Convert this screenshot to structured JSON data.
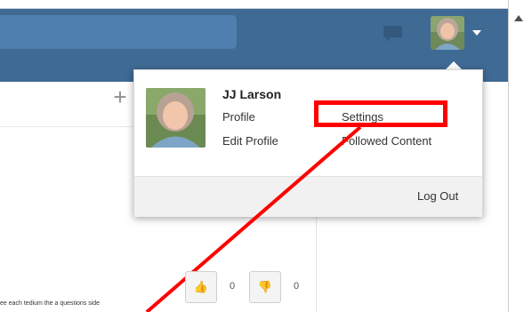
{
  "user": {
    "name": "JJ Larson"
  },
  "menu": {
    "profile": "Profile",
    "edit_profile": "Edit Profile",
    "settings": "Settings",
    "followed_content": "Followed Content",
    "logout": "Log Out"
  },
  "toolbar": {
    "plus": "+"
  },
  "votes": {
    "up_icon": "👍",
    "up_count": "0",
    "down_icon": "👎",
    "down_count": "0"
  },
  "bottom_note": "ee each tedium the a questions side",
  "colors": {
    "header": "#3f6a94",
    "search": "#4f7fae",
    "highlight": "#ff0000"
  },
  "icons": {
    "chat": "chat-bubble-icon",
    "caret": "caret-down-icon",
    "scroll": "scroll-up-arrow-icon"
  }
}
